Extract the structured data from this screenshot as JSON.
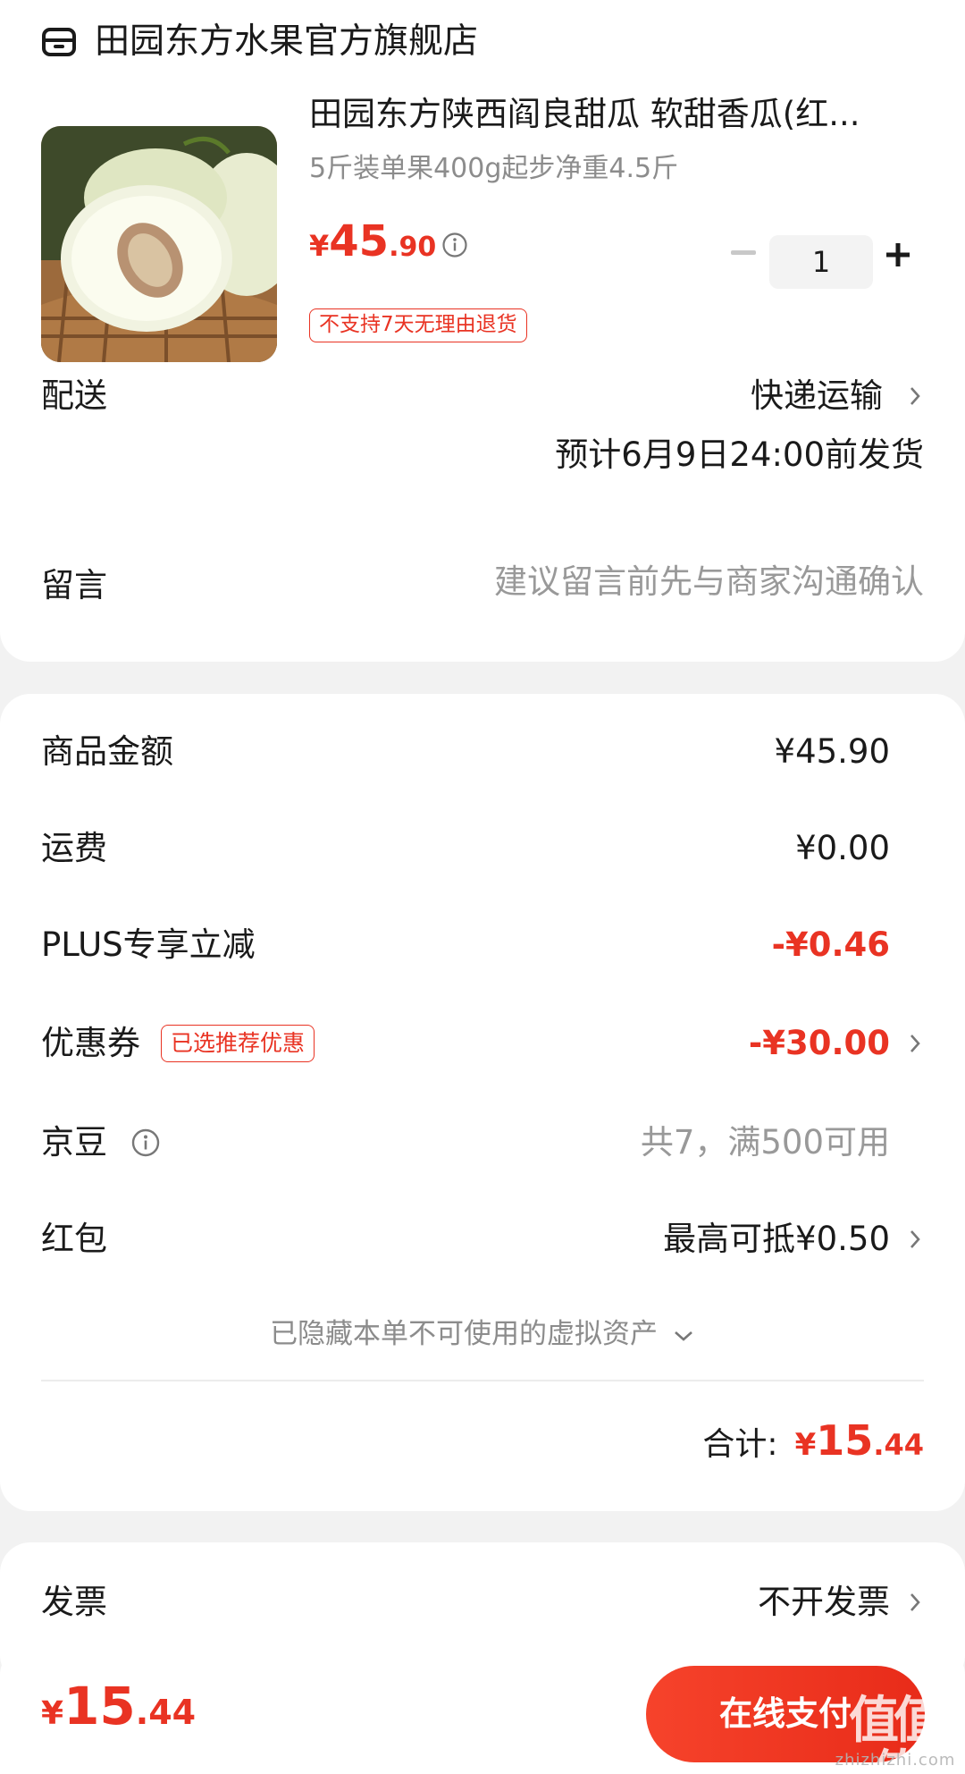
{
  "store": {
    "name": "田园东方水果官方旗舰店",
    "icon": "store-icon"
  },
  "product": {
    "title": "田园东方陕西阎良甜瓜 软甜香瓜(红...",
    "spec": "5斤装单果400g起步净重4.5斤",
    "price_currency": "¥",
    "price_int": "45",
    "price_dec": ".90",
    "quantity": "1",
    "return_policy": "不支持7天无理由退货"
  },
  "delivery": {
    "label": "配送",
    "method": "快递运输",
    "eta": "预计6月9日24:00前发货"
  },
  "remark": {
    "label": "留言",
    "placeholder": "建议留言前先与商家沟通确认"
  },
  "summary": {
    "goods_label": "商品金额",
    "goods_value": "¥45.90",
    "shipping_label": "运费",
    "shipping_value": "¥0.00",
    "plus_label": "PLUS专享立减",
    "plus_value": "-¥0.46",
    "coupon_label": "优惠券",
    "coupon_badge": "已选推荐优惠",
    "coupon_value": "-¥30.00",
    "jingdou_label": "京豆",
    "jingdou_value": "共7，满500可用",
    "redpacket_label": "红包",
    "redpacket_value": "最高可抵¥0.50",
    "hidden_note": "已隐藏本单不可使用的虚拟资产",
    "total_label": "合计:",
    "total_currency": "¥",
    "total_int": "15",
    "total_dec": ".44"
  },
  "invoice": {
    "label": "发票",
    "value": "不开发票"
  },
  "bottom_bar": {
    "price_currency": "¥",
    "price_int": "15",
    "price_dec": ".44",
    "pay_label": "在线支付",
    "watermark": "值",
    "watermark_sub": "zhizhizhi.com"
  },
  "colors": {
    "accent": "#e93323",
    "background": "#f2f2f2",
    "muted_text": "#999999"
  }
}
